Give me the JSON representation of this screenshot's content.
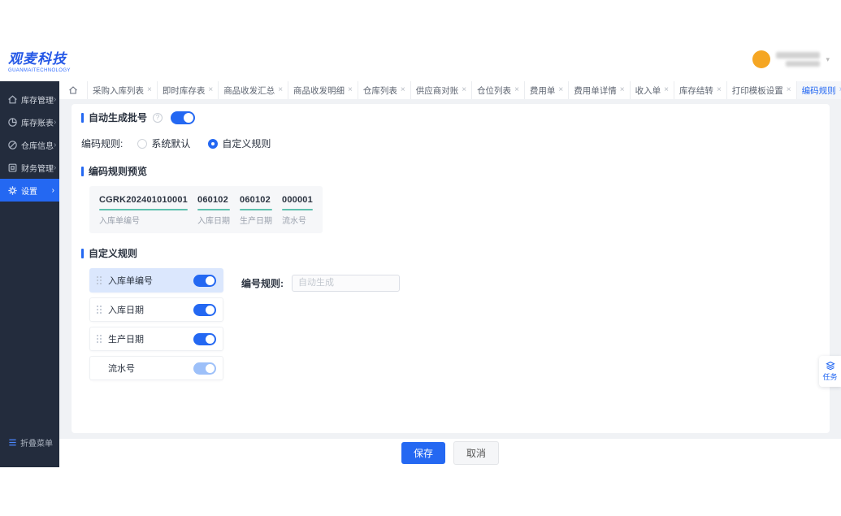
{
  "brand": {
    "logo_text": "观麦科技",
    "logo_subtext": "GUANMAITECHNOLOGY"
  },
  "sidebar": {
    "items": [
      {
        "id": "inventory-management",
        "label": "库存管理",
        "icon": "home-icon",
        "active": false
      },
      {
        "id": "inventory-ledger",
        "label": "库存账表",
        "icon": "pie-chart-icon",
        "active": false
      },
      {
        "id": "warehouse-info",
        "label": "仓库信息",
        "icon": "warehouse-icon",
        "active": false
      },
      {
        "id": "finance-management",
        "label": "财务管理",
        "icon": "ledger-icon",
        "active": false
      },
      {
        "id": "settings",
        "label": "设置",
        "icon": "gear-icon",
        "active": true
      }
    ],
    "collapse_label": "折叠菜单"
  },
  "tabbar": {
    "tabs": [
      "采购入库列表",
      "即时库存表",
      "商品收发汇总",
      "商品收发明细",
      "仓库列表",
      "供应商对账",
      "仓位列表",
      "费用单",
      "费用单详情",
      "收入单",
      "库存结转",
      "打印模板设置",
      "编码规则"
    ],
    "active_tab": "编码规则",
    "close_glyph": "×"
  },
  "content": {
    "auto_batch_label": "自动生成批号",
    "help_glyph": "?",
    "coding_rule_label": "编码规则:",
    "radio_options": [
      {
        "label": "系统默认",
        "selected": false
      },
      {
        "label": "自定义规则",
        "selected": true
      }
    ],
    "preview_section_title": "编码规则预览",
    "preview_segments": [
      {
        "value": "CGRK202401010001",
        "label": "入库单编号"
      },
      {
        "value": "060102",
        "label": "入库日期"
      },
      {
        "value": "060102",
        "label": "生产日期"
      },
      {
        "value": "000001",
        "label": "流水号"
      }
    ],
    "custom_section_title": "自定义规则",
    "rule_items": [
      {
        "label": "入库单编号",
        "enabled": true,
        "highlighted": true,
        "draggable": true,
        "toggle_light": false
      },
      {
        "label": "入库日期",
        "enabled": true,
        "highlighted": false,
        "draggable": true,
        "toggle_light": false
      },
      {
        "label": "生产日期",
        "enabled": true,
        "highlighted": false,
        "draggable": true,
        "toggle_light": false
      },
      {
        "label": "流水号",
        "enabled": true,
        "highlighted": false,
        "draggable": false,
        "toggle_light": true
      }
    ],
    "number_rule_label": "编号规则:",
    "number_rule_placeholder": "自动生成"
  },
  "footer": {
    "save_label": "保存",
    "cancel_label": "取消"
  },
  "task_button": {
    "label": "任务"
  },
  "colors": {
    "accent": "#2468f2",
    "sidebar": "#232c3d",
    "teal_underline": "#5ec0ae",
    "row_highlight": "#dbe7fd",
    "content_bg": "#f0f2f5",
    "avatar": "#f5a623"
  }
}
